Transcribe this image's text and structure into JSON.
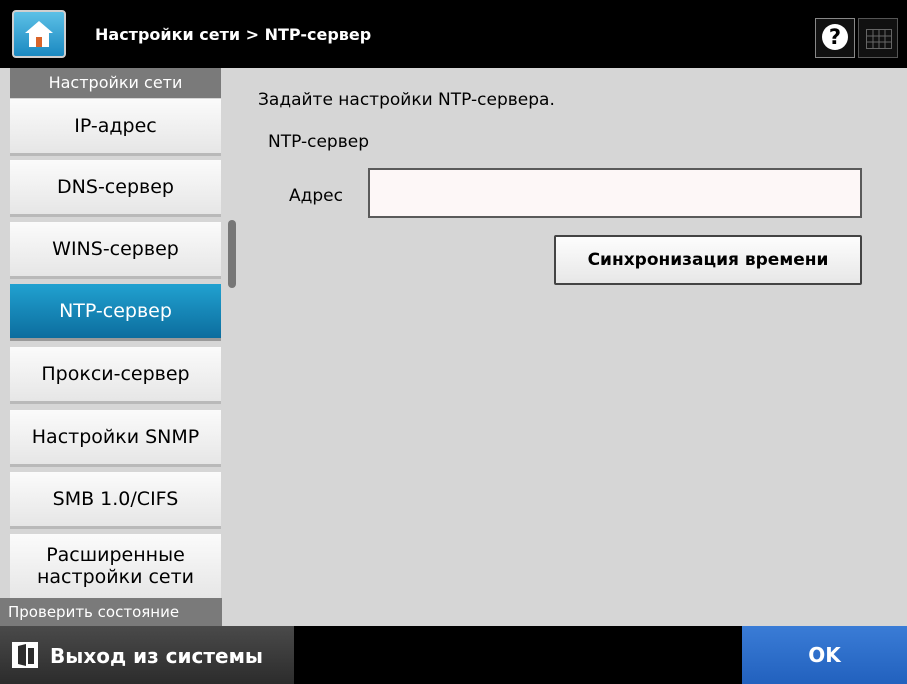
{
  "header": {
    "breadcrumb": "Настройки сети > NTP-сервер",
    "help_label": "?",
    "icons": {
      "home": "home-icon",
      "help": "help-icon",
      "keyboard": "keyboard-icon"
    }
  },
  "sidebar": {
    "header": "Настройки сети",
    "items": [
      {
        "label": "IP-адрес",
        "active": false
      },
      {
        "label": "DNS-сервер",
        "active": false
      },
      {
        "label": "WINS-сервер",
        "active": false
      },
      {
        "label": "NTP-сервер",
        "active": true
      },
      {
        "label": "Прокси-сервер",
        "active": false
      },
      {
        "label": "Настройки SNMP",
        "active": false
      },
      {
        "label": "SMB 1.0/CIFS",
        "active": false
      },
      {
        "label": "Расширенные настройки сети",
        "active": false
      }
    ],
    "footer": "Проверить состояние"
  },
  "main": {
    "intro": "Задайте настройки NTP-сервера.",
    "section_title": "NTP-сервер",
    "address_label": "Адрес",
    "address_value": "",
    "sync_button": "Синхронизация времени"
  },
  "footer": {
    "logout_label": "Выход из системы",
    "ok_label": "OK"
  },
  "colors": {
    "accent_active": "#1a8fc4",
    "ok_button": "#2a6dcc",
    "panel_bg": "#d6d6d6"
  }
}
